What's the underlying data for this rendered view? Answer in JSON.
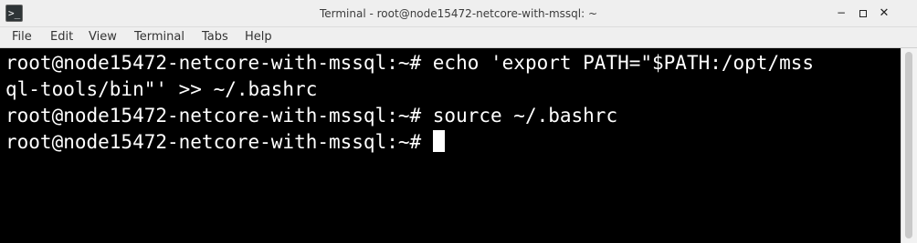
{
  "window": {
    "title": "Terminal - root@node15472-netcore-with-mssql: ~",
    "minimize_glyph": "−",
    "close_glyph": "✕",
    "app_icon": "terminal-icon",
    "app_icon_glyph": ">_"
  },
  "menubar": {
    "items": [
      "File",
      "Edit",
      "View",
      "Terminal",
      "Tabs",
      "Help"
    ]
  },
  "terminal": {
    "lines": [
      "root@node15472-netcore-with-mssql:~# echo 'export PATH=\"$PATH:/opt/mss",
      "ql-tools/bin\"' >> ~/.bashrc",
      "root@node15472-netcore-with-mssql:~# source ~/.bashrc",
      "root@node15472-netcore-with-mssql:~# "
    ],
    "background": "#000000",
    "foreground": "#ffffff"
  }
}
